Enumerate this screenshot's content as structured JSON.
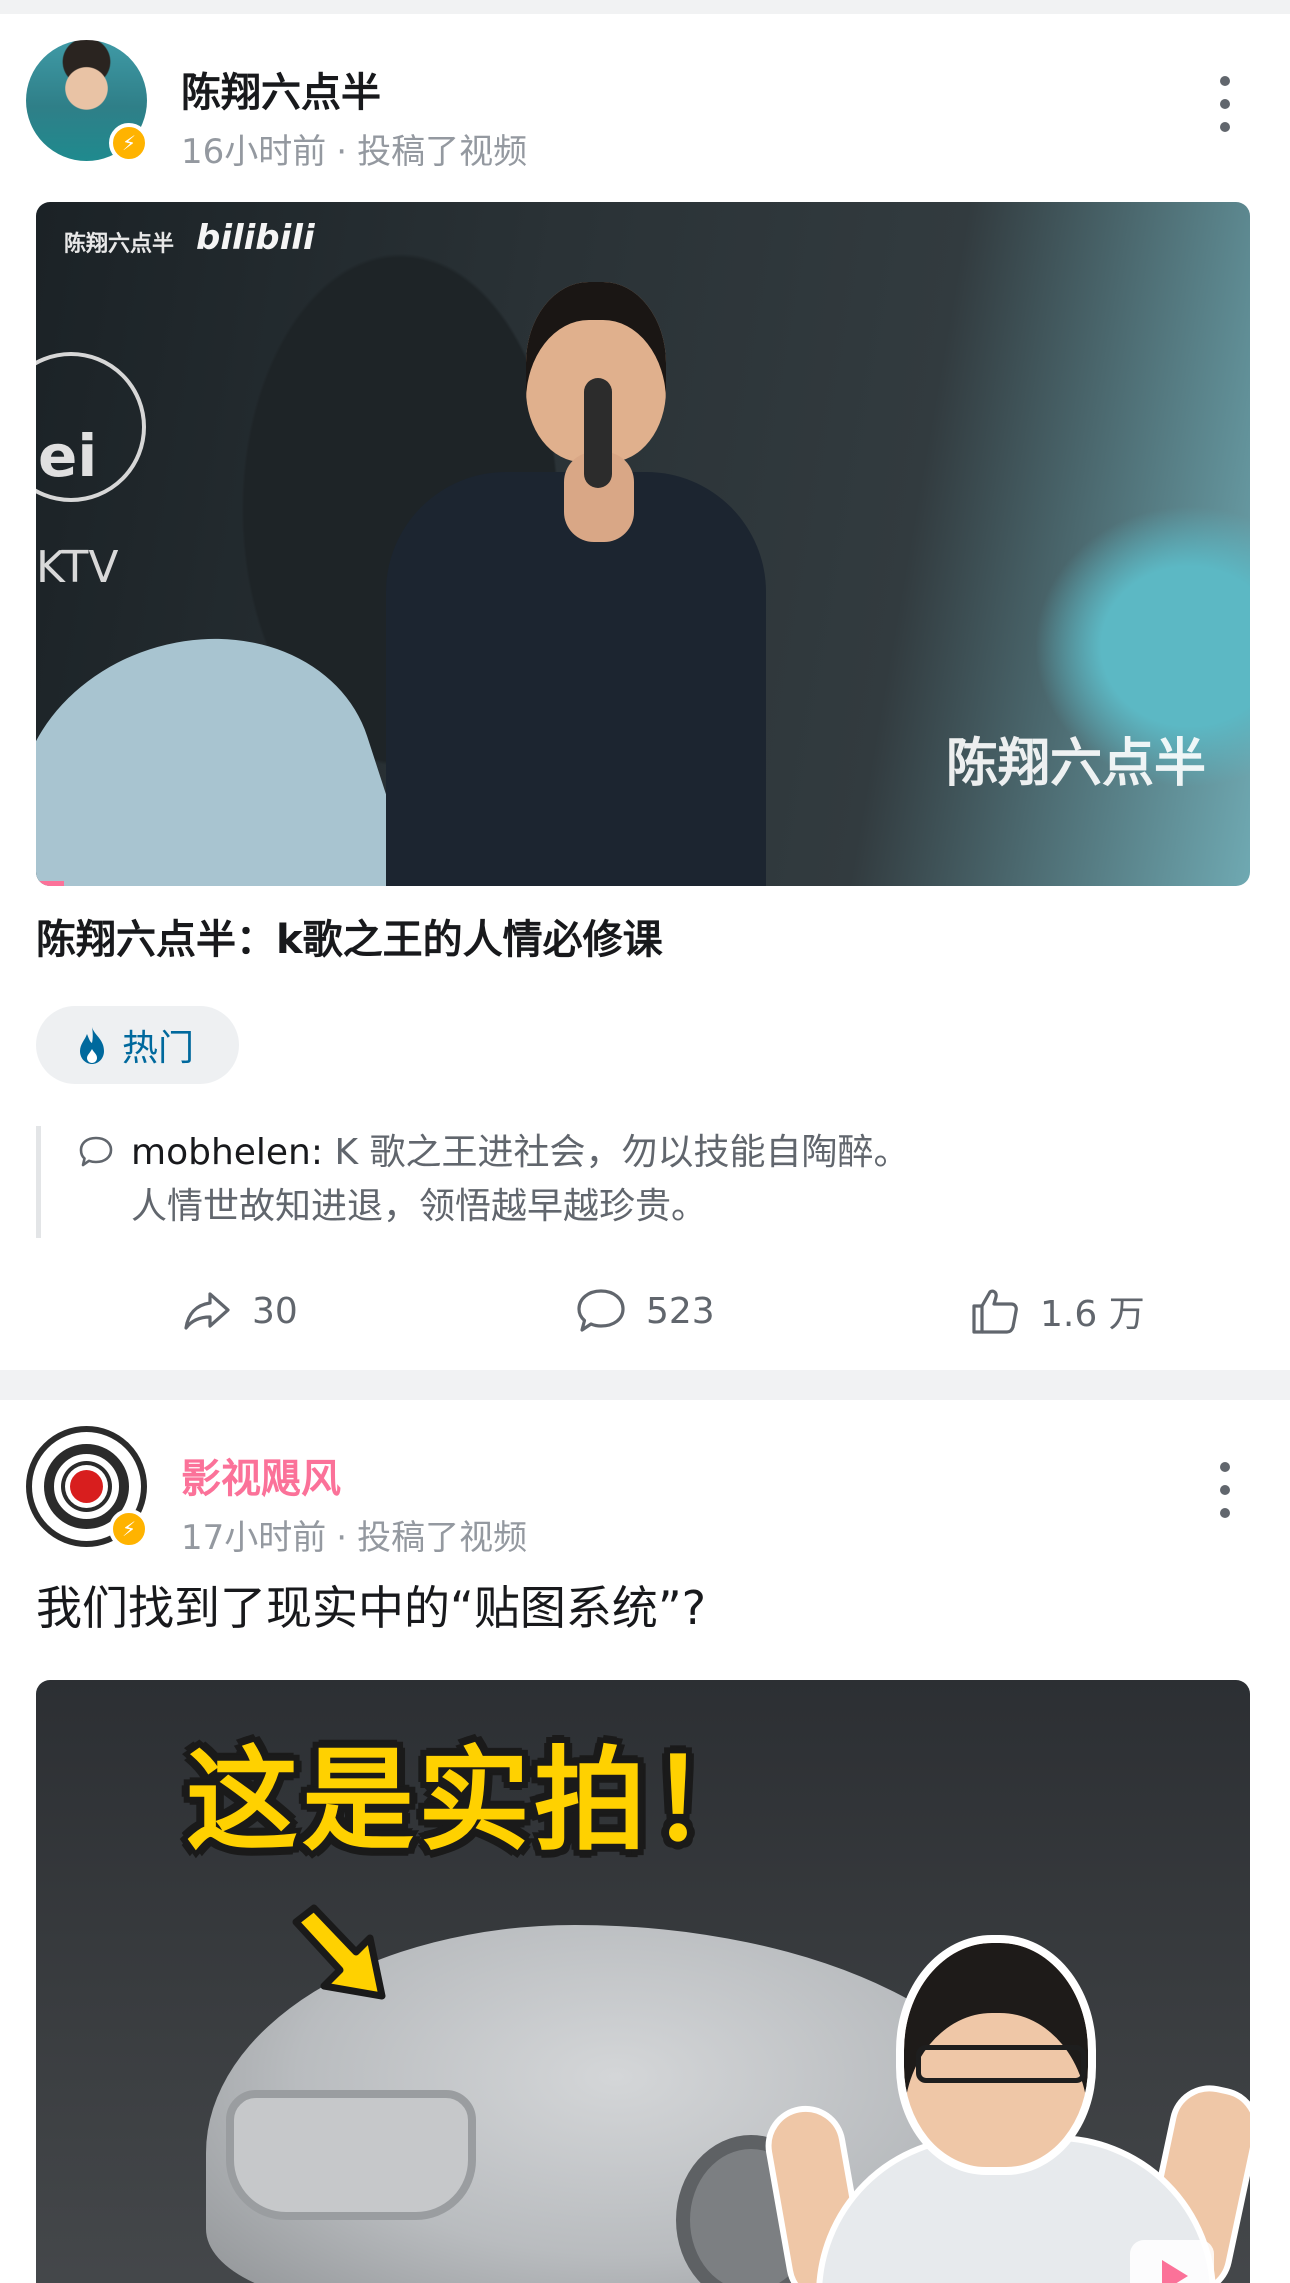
{
  "feed": [
    {
      "author": "陈翔六点半",
      "time": "16小时前",
      "separator": "·",
      "action": "投稿了视频",
      "thumbnail": {
        "watermark_top_left": "陈翔六点半",
        "watermark_brand": "bilibili",
        "watermark_bottom_right": "陈翔六点半",
        "sign_text": "ei",
        "ktv_text": "KTV"
      },
      "title": "陈翔六点半：k歌之王的人情必修课",
      "tag": "热门",
      "top_comment": {
        "user": "mobhelen:",
        "line1": " K 歌之王进社会，勿以技能自陶醉。",
        "line2": "人情世故知进退，领悟越早越珍贵。"
      },
      "stats": {
        "shares": "30",
        "comments": "523",
        "likes": "1.6 万"
      }
    },
    {
      "author": "影视飓风",
      "time": "17小时前",
      "separator": "·",
      "action": "投稿了视频",
      "title": "我们找到了现实中的“贴图系统”?",
      "thumbnail": {
        "headline": "这是实拍！"
      }
    }
  ],
  "colors": {
    "brand_pink": "#fb7299",
    "tag_blue": "#00699d",
    "badge_yellow": "#ffb300",
    "text_gray": "#9499a0"
  }
}
